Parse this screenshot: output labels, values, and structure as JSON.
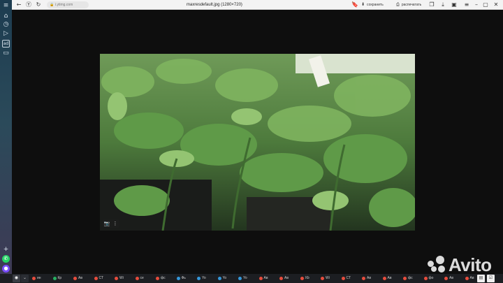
{
  "browser": {
    "url_text": "i.ytimg.com",
    "page_title": "maxresdefault.jpg (1280×720)",
    "actions": {
      "save_label": "сохранить",
      "print_label": "распечатать"
    }
  },
  "icons": {
    "back": "arrow-left-icon",
    "forward": "arrow-right-icon",
    "reload": "reload-icon",
    "bookmark": "bookmark-icon"
  },
  "sidebar": {
    "items": [
      "home-icon",
      "history-icon",
      "play-icon",
      "ad-badge-icon",
      "screen-icon"
    ],
    "badge_text": "ad"
  },
  "taskbar": {
    "tasks": [
      {
        "label": "ин",
        "color": "#e74c3c"
      },
      {
        "label": "Кр",
        "color": "#27ae60"
      },
      {
        "label": "Ав",
        "color": "#e74c3c"
      },
      {
        "label": "СТ",
        "color": "#e74c3c"
      },
      {
        "label": "Wi",
        "color": "#e74c3c"
      },
      {
        "label": "ce",
        "color": "#e74c3c"
      },
      {
        "label": "фс",
        "color": "#e74c3c"
      },
      {
        "label": "Фь",
        "color": "#3498db"
      },
      {
        "label": "Yo",
        "color": "#3498db"
      },
      {
        "label": "Yo",
        "color": "#3498db"
      },
      {
        "label": "Yo",
        "color": "#3498db"
      },
      {
        "label": "Ав",
        "color": "#e74c3c"
      },
      {
        "label": "Ав",
        "color": "#e74c3c"
      },
      {
        "label": "Xb",
        "color": "#e74c3c"
      },
      {
        "label": "Wi",
        "color": "#e74c3c"
      },
      {
        "label": "СТ",
        "color": "#e74c3c"
      },
      {
        "label": "Ав",
        "color": "#e74c3c"
      },
      {
        "label": "Ав",
        "color": "#e74c3c"
      },
      {
        "label": "фс",
        "color": "#e74c3c"
      },
      {
        "label": "фо",
        "color": "#e74c3c"
      },
      {
        "label": "Ав",
        "color": "#e74c3c"
      },
      {
        "label": "Ав",
        "color": "#e74c3c"
      }
    ]
  },
  "watermark": {
    "text": "Avito"
  }
}
